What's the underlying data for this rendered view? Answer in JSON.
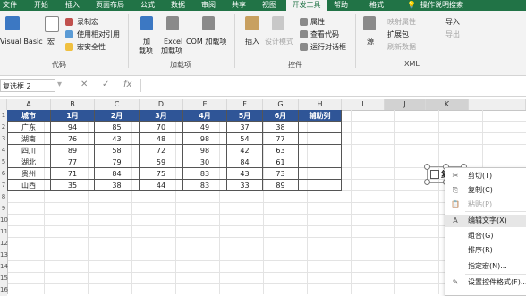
{
  "tabs": [
    {
      "label": "文件"
    },
    {
      "label": "开始"
    },
    {
      "label": "插入"
    },
    {
      "label": "页面布局"
    },
    {
      "label": "公式"
    },
    {
      "label": "数据"
    },
    {
      "label": "审阅"
    },
    {
      "label": "共享"
    },
    {
      "label": "视图"
    },
    {
      "label": "开发工具"
    },
    {
      "label": "帮助"
    },
    {
      "label": "格式"
    }
  ],
  "tell_me": "操作说明搜索",
  "ribbon": {
    "code": {
      "visual_basic": "Visual Basic",
      "macros": "宏",
      "record_macro": "录制宏",
      "relative_refs": "使用相对引用",
      "macro_security": "宏安全性",
      "group": "代码"
    },
    "addins": {
      "addins_a": "加",
      "addins_b": "载项",
      "excel_addins_a": "Excel",
      "excel_addins_b": "加载项",
      "com_addins": "COM 加载项",
      "group": "加载项"
    },
    "controls": {
      "insert": "插入",
      "design_mode": "设计模式",
      "properties": "属性",
      "view_code": "查看代码",
      "run_dialog": "运行对话框",
      "group": "控件"
    },
    "xml": {
      "source": "源",
      "map_props": "映射属性",
      "expansion": "扩展包",
      "refresh": "刷新数据",
      "import": "导入",
      "export": "导出",
      "group": "XML"
    }
  },
  "formula_bar": {
    "name_box": "复选框 2",
    "cancel": "✕",
    "enter": "✓",
    "fx": "fx",
    "content": ""
  },
  "columns": [
    "A",
    "B",
    "C",
    "D",
    "E",
    "F",
    "G",
    "H",
    "I",
    "J",
    "K",
    "L"
  ],
  "row_numbers": [
    "1",
    "2",
    "3",
    "4",
    "5",
    "6",
    "7",
    "8",
    "9",
    "10",
    "11",
    "12",
    "13",
    "14",
    "15",
    "16"
  ],
  "table": {
    "headers": [
      "城市",
      "1月",
      "2月",
      "3月",
      "4月",
      "5月",
      "6月",
      "辅助列"
    ],
    "rows": [
      [
        "广东",
        "94",
        "85",
        "70",
        "49",
        "37",
        "38",
        ""
      ],
      [
        "湖南",
        "76",
        "43",
        "48",
        "98",
        "54",
        "77",
        ""
      ],
      [
        "四川",
        "89",
        "58",
        "72",
        "98",
        "42",
        "63",
        ""
      ],
      [
        "湖北",
        "77",
        "79",
        "59",
        "30",
        "84",
        "61",
        ""
      ],
      [
        "贵州",
        "71",
        "84",
        "75",
        "83",
        "43",
        "73",
        ""
      ],
      [
        "山西",
        "35",
        "38",
        "44",
        "83",
        "33",
        "89",
        ""
      ]
    ]
  },
  "checkbox_label": "复",
  "context_menu": [
    {
      "label": "剪切(T)",
      "icon": "✂",
      "disabled": false
    },
    {
      "label": "复制(C)",
      "icon": "⎘",
      "disabled": false
    },
    {
      "label": "粘贴(P)",
      "icon": "📋",
      "disabled": true
    },
    {
      "label": "编辑文字(X)",
      "icon": "A",
      "disabled": false,
      "highlighted": true
    },
    {
      "label": "组合(G)",
      "icon": "",
      "disabled": false
    },
    {
      "label": "排序(R)",
      "icon": "",
      "disabled": false
    },
    {
      "label": "指定宏(N)...",
      "icon": "",
      "disabled": false
    },
    {
      "label": "设置控件格式(F)...",
      "icon": "✎",
      "disabled": false
    }
  ],
  "colors": {
    "ribbon_green": "#217346",
    "header_fill": "#2f5597"
  }
}
